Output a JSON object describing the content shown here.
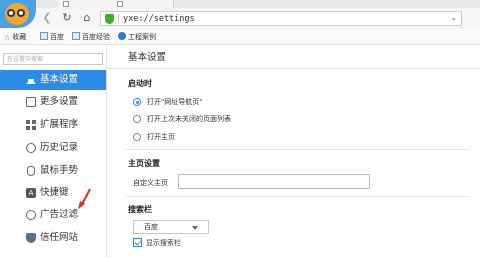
{
  "browser": {
    "address": "yxe://settings",
    "bookmarks": {
      "favorites_label": "收藏",
      "items": [
        "百度",
        "百度经验",
        "工程案例"
      ]
    }
  },
  "sidebar": {
    "search_placeholder": "在设置中搜索",
    "items": [
      {
        "label": "基本设置",
        "icon": "home-icon",
        "active": true
      },
      {
        "label": "更多设置",
        "icon": "settings-box-icon"
      },
      {
        "label": "扩展程序",
        "icon": "extensions-grid-icon"
      },
      {
        "label": "历史记录",
        "icon": "history-clock-icon"
      },
      {
        "label": "鼠标手势",
        "icon": "mouse-icon"
      },
      {
        "label": "快捷键",
        "icon": "shortcut-key-icon"
      },
      {
        "label": "广告过滤",
        "icon": "ad-block-icon"
      },
      {
        "label": "信任网站",
        "icon": "trusted-shield-icon"
      }
    ]
  },
  "main": {
    "title": "基本设置",
    "startup": {
      "title": "启动时",
      "options": [
        "打开\"网址导航页\"",
        "打开上次未关闭的页面列表",
        "打开主页"
      ],
      "selected": 0
    },
    "homepage": {
      "title": "主页设置",
      "label": "自定义主页",
      "value": ""
    },
    "search": {
      "title": "搜索栏",
      "engine": "百度",
      "show_label": "显示搜索栏",
      "show_checked": true
    }
  },
  "colors": {
    "accent": "#2d8be8",
    "annotation_arrow": "#e8262b"
  }
}
